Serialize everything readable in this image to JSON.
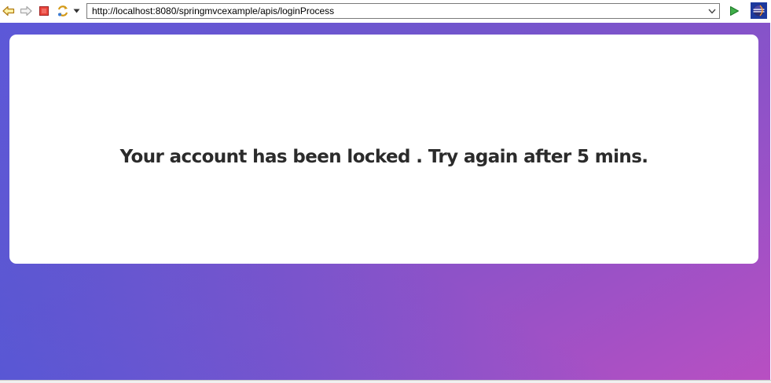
{
  "browser": {
    "url": "http://localhost:8080/springmvcexample/apis/loginProcess",
    "buttons": {
      "back": "back-arrow-icon",
      "forward": "forward-arrow-icon",
      "stop": "stop-icon",
      "refresh": "refresh-icon",
      "go": "go-play-icon"
    }
  },
  "page": {
    "message": "Your account has been locked . Try again after 5 mins."
  },
  "colors": {
    "gradient_start": "#4a5ad8",
    "gradient_end": "#b84fc2",
    "card": "#ffffff",
    "text": "#2b2b2b"
  }
}
